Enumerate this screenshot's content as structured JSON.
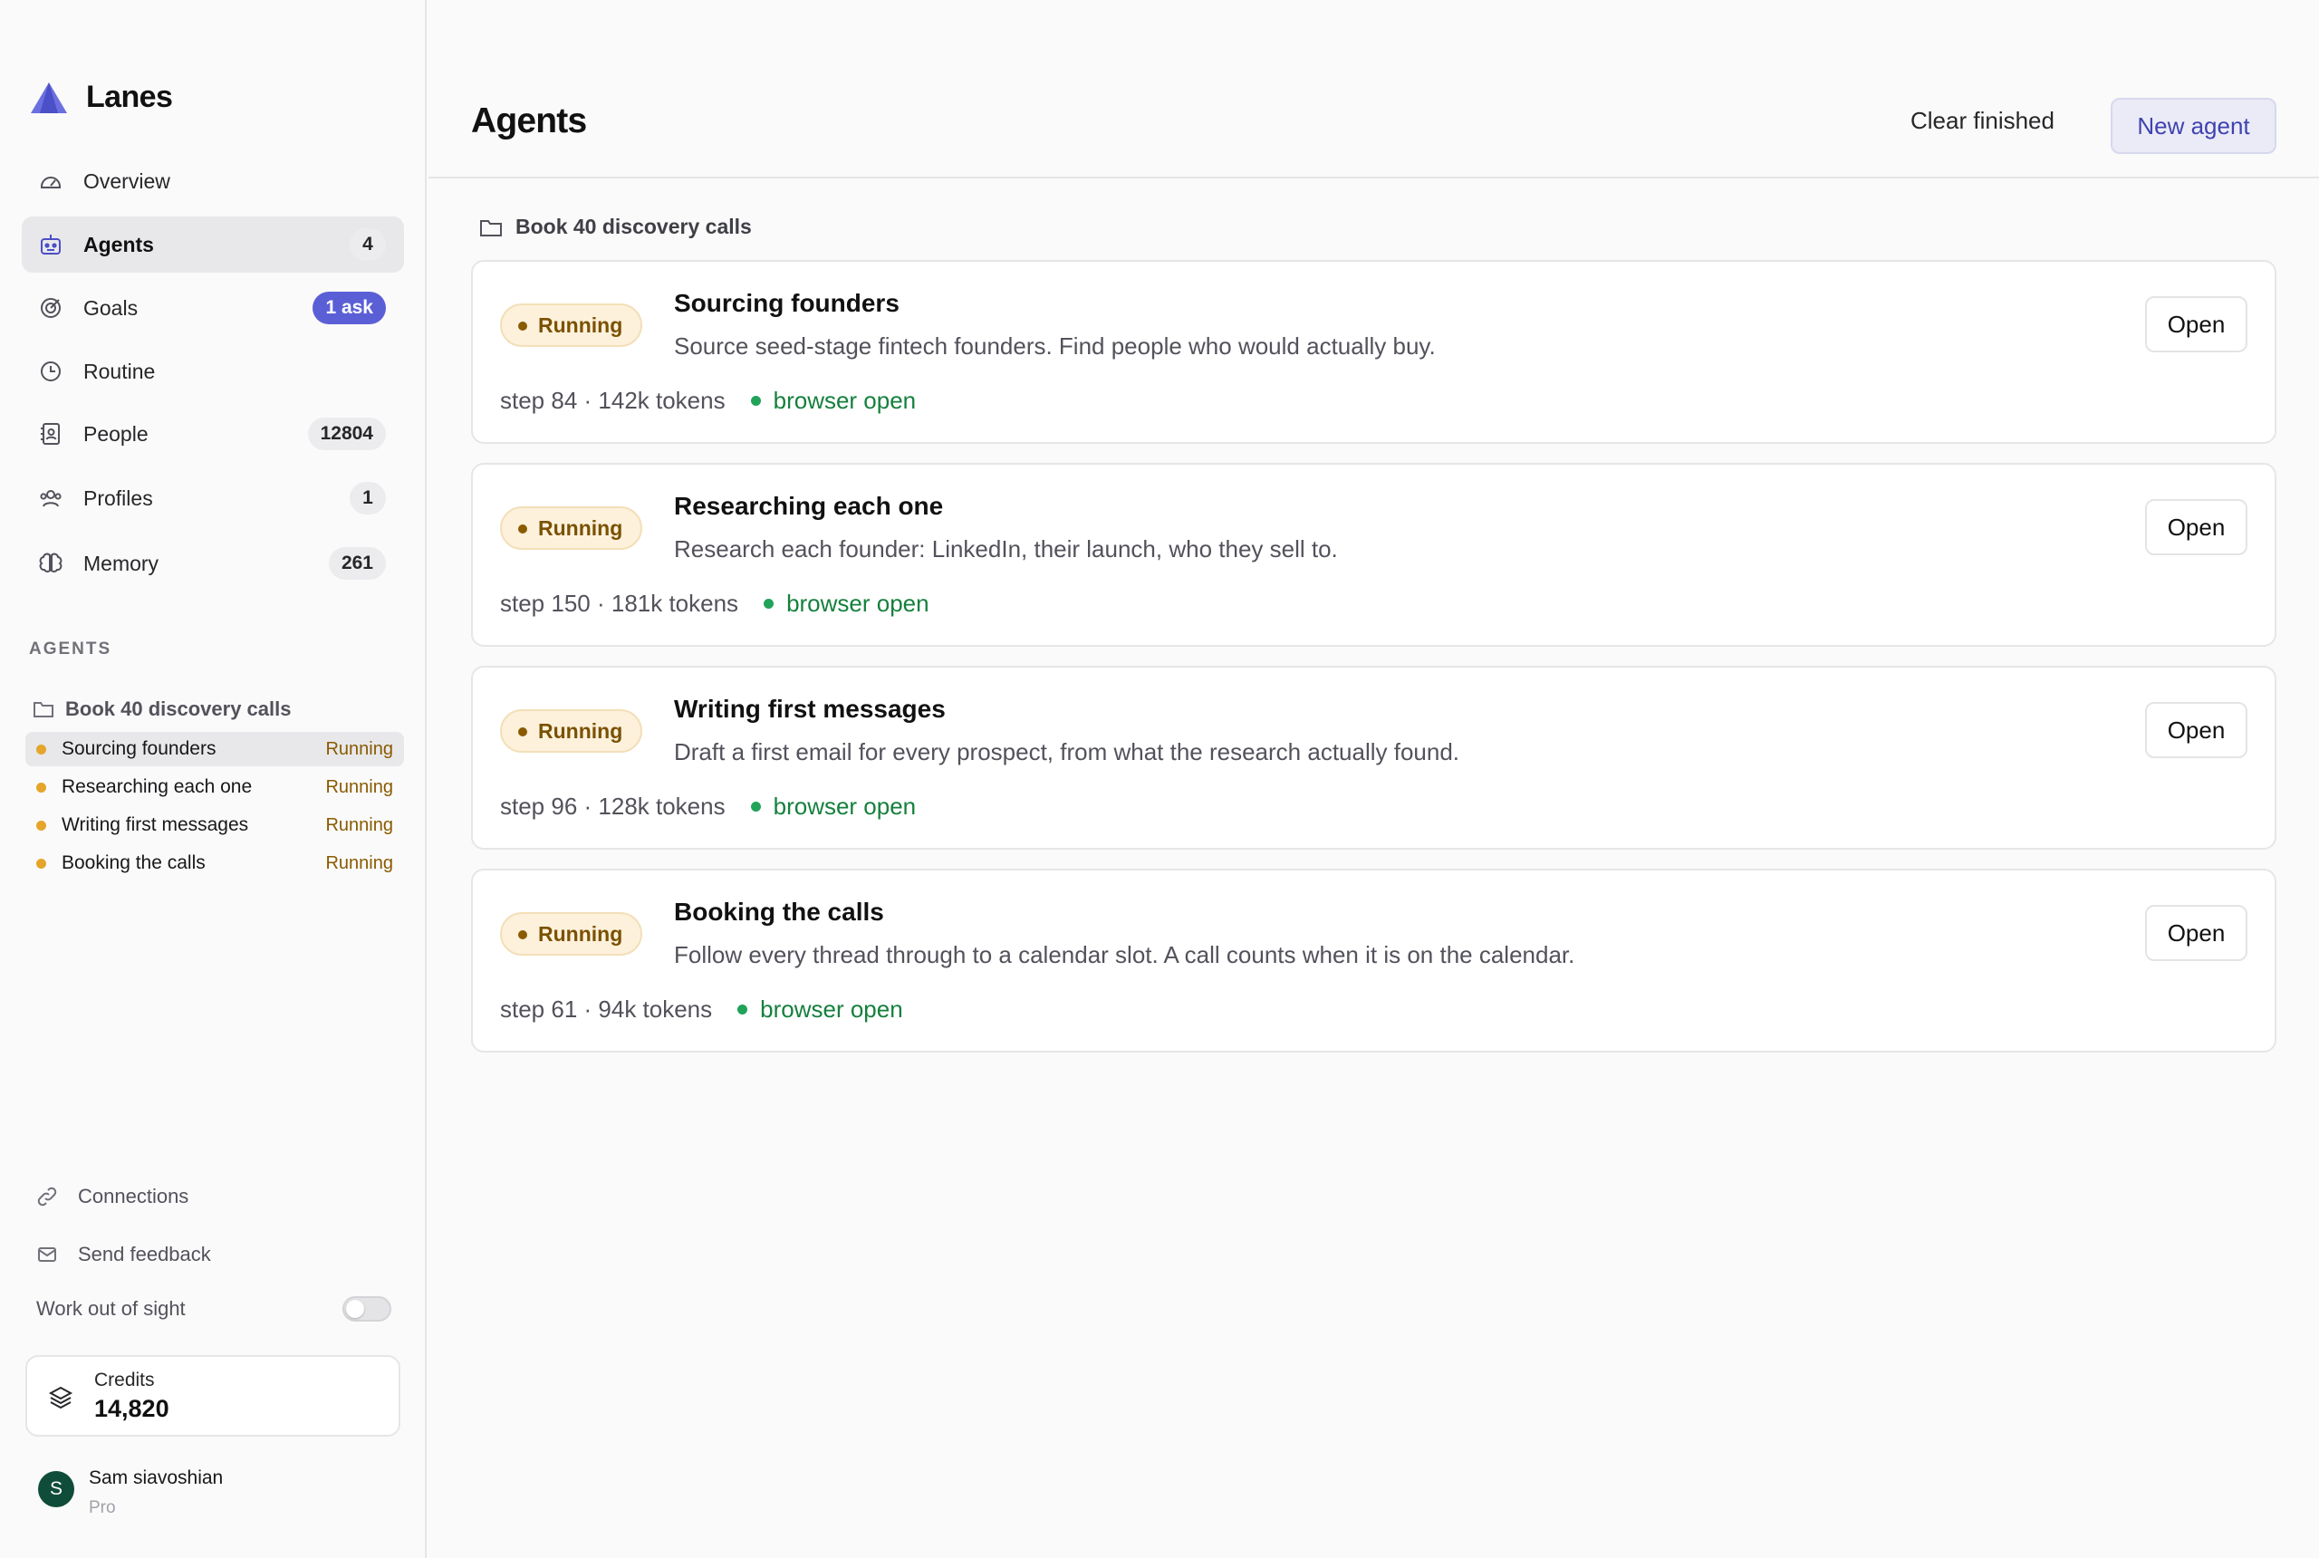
{
  "app": {
    "name": "Lanes",
    "brand_color": "#5b5fd6"
  },
  "nav": [
    {
      "label": "Overview",
      "badge": "",
      "icon": "gauge-icon",
      "active": false
    },
    {
      "label": "Agents",
      "badge": "4",
      "icon": "robot-icon",
      "active": true
    },
    {
      "label": "Goals",
      "badge": "1 ask",
      "icon": "target-icon",
      "active": false
    },
    {
      "label": "Routine",
      "badge": "",
      "icon": "clock-icon",
      "active": false
    },
    {
      "label": "People",
      "badge": "12804",
      "icon": "contact-book-icon",
      "active": false
    },
    {
      "label": "Profiles",
      "badge": "1",
      "icon": "users-icon",
      "active": false
    },
    {
      "label": "Memory",
      "badge": "261",
      "icon": "brain-icon",
      "active": false
    }
  ],
  "sidebar_agents": {
    "heading": "AGENTS",
    "folder": "Book 40 discovery calls",
    "items": [
      {
        "name": "Sourcing founders",
        "status": "Running"
      },
      {
        "name": "Researching each one",
        "status": "Running"
      },
      {
        "name": "Writing first messages",
        "status": "Running"
      },
      {
        "name": "Booking the calls",
        "status": "Running"
      }
    ]
  },
  "footer": {
    "connections": "Connections",
    "feedback": "Send feedback",
    "work_out_of_sight": "Work out of sight",
    "work_out_of_sight_on": false,
    "credits_label": "Credits",
    "credits_value": "14,820",
    "user_initial": "S",
    "user_name": "Sam siavoshian",
    "user_plan": "Pro"
  },
  "header": {
    "title": "Agents",
    "clear_label": "Clear finished",
    "new_label": "New agent"
  },
  "group": {
    "label": "Book 40 discovery calls"
  },
  "cards": [
    {
      "status": "Running",
      "title": "Sourcing founders",
      "desc": "Source seed-stage fintech founders. Find people who would actually buy.",
      "meta": "step 84 · 142k tokens",
      "browser": "browser open",
      "open": "Open"
    },
    {
      "status": "Running",
      "title": "Researching each one",
      "desc": "Research each founder: LinkedIn, their launch, who they sell to.",
      "meta": "step 150 · 181k tokens",
      "browser": "browser open",
      "open": "Open"
    },
    {
      "status": "Running",
      "title": "Writing first messages",
      "desc": "Draft a first email for every prospect, from what the research actually found.",
      "meta": "step 96 · 128k tokens",
      "browser": "browser open",
      "open": "Open"
    },
    {
      "status": "Running",
      "title": "Booking the calls",
      "desc": "Follow every thread through to a calendar slot. A call counts when it is on the calendar.",
      "meta": "step 61 · 94k tokens",
      "browser": "browser open",
      "open": "Open"
    }
  ],
  "colors": {
    "running_text": "#8a5a00",
    "running_bg": "#fdf1dc",
    "browser_green": "#15803d",
    "accent": "#5b5fd6"
  }
}
